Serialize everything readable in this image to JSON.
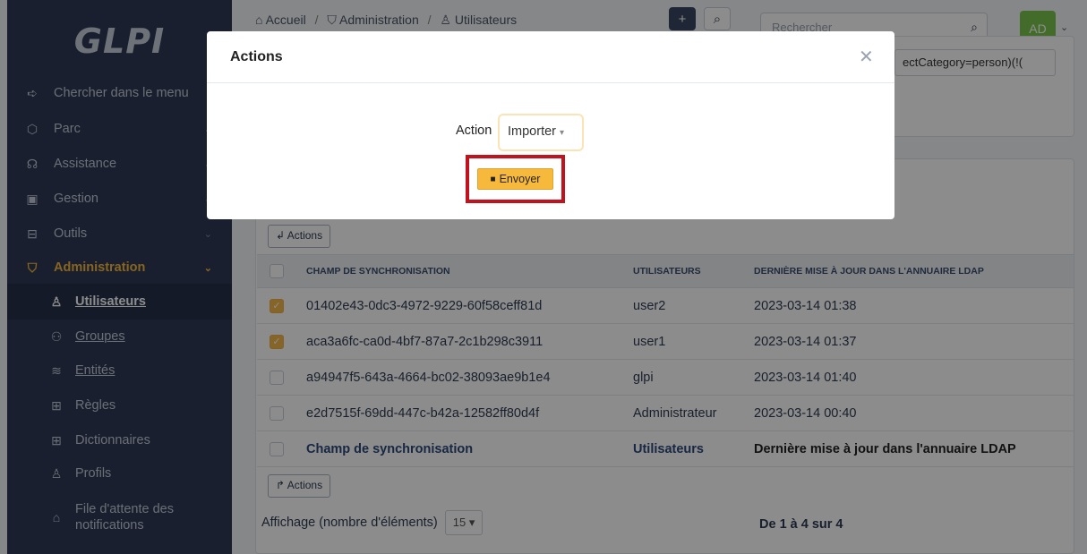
{
  "logo": "GLPI",
  "sidebar": {
    "items": [
      {
        "icon": "arrow-right-icon",
        "label": "Chercher dans le menu"
      },
      {
        "icon": "cube-icon",
        "label": "Parc"
      },
      {
        "icon": "headset-icon",
        "label": "Assistance"
      },
      {
        "icon": "wallet-icon",
        "label": "Gestion"
      },
      {
        "icon": "briefcase-icon",
        "label": "Outils"
      },
      {
        "icon": "shield-icon",
        "label": "Administration"
      }
    ],
    "subitems": [
      {
        "icon": "user-icon",
        "label": "Utilisateurs"
      },
      {
        "icon": "users-icon",
        "label": "Groupes"
      },
      {
        "icon": "layers-icon",
        "label": "Entités"
      },
      {
        "icon": "book-icon",
        "label": "Règles"
      },
      {
        "icon": "book-icon",
        "label": "Dictionnaires"
      },
      {
        "icon": "user-check-icon",
        "label": "Profils"
      },
      {
        "icon": "bell-icon",
        "label": "File d'attente des notifications"
      }
    ]
  },
  "breadcrumb": [
    "Accueil",
    "Administration",
    "Utilisateurs"
  ],
  "search": {
    "placeholder": "Rechercher"
  },
  "user": {
    "initials": "AD"
  },
  "ldap_filter": "ectCategory=person)(!(",
  "table": {
    "actions_label": "Actions",
    "headers": [
      "CHAMP DE SYNCHRONISATION",
      "UTILISATEURS",
      "DERNIÈRE MISE À JOUR DANS L'ANNUAIRE LDAP"
    ],
    "rows": [
      {
        "checked": true,
        "sync": "01402e43-0dc3-4972-9229-60f58ceff81d",
        "user": "user2",
        "date": "2023-03-14 01:38"
      },
      {
        "checked": true,
        "sync": "aca3a6fc-ca0d-4bf7-87a7-2c1b298c3911",
        "user": "user1",
        "date": "2023-03-14 01:37"
      },
      {
        "checked": false,
        "sync": "a94947f5-643a-4664-bc02-38093ae9b1e4",
        "user": "glpi",
        "date": "2023-03-14 01:40"
      },
      {
        "checked": false,
        "sync": "e2d7515f-69dd-447c-b42a-12582ff80d4f",
        "user": "Administrateur",
        "date": "2023-03-14 00:40"
      }
    ],
    "footer": [
      "Champ de synchronisation",
      "Utilisateurs",
      "Dernière mise à jour dans l'annuaire LDAP"
    ]
  },
  "pager": {
    "label": "Affichage (nombre d'éléments)",
    "value": "15",
    "count": "De 1 à 4 sur 4"
  },
  "modal": {
    "title": "Actions",
    "action_label": "Action",
    "action_value": "Importer",
    "send_label": "Envoyer"
  }
}
